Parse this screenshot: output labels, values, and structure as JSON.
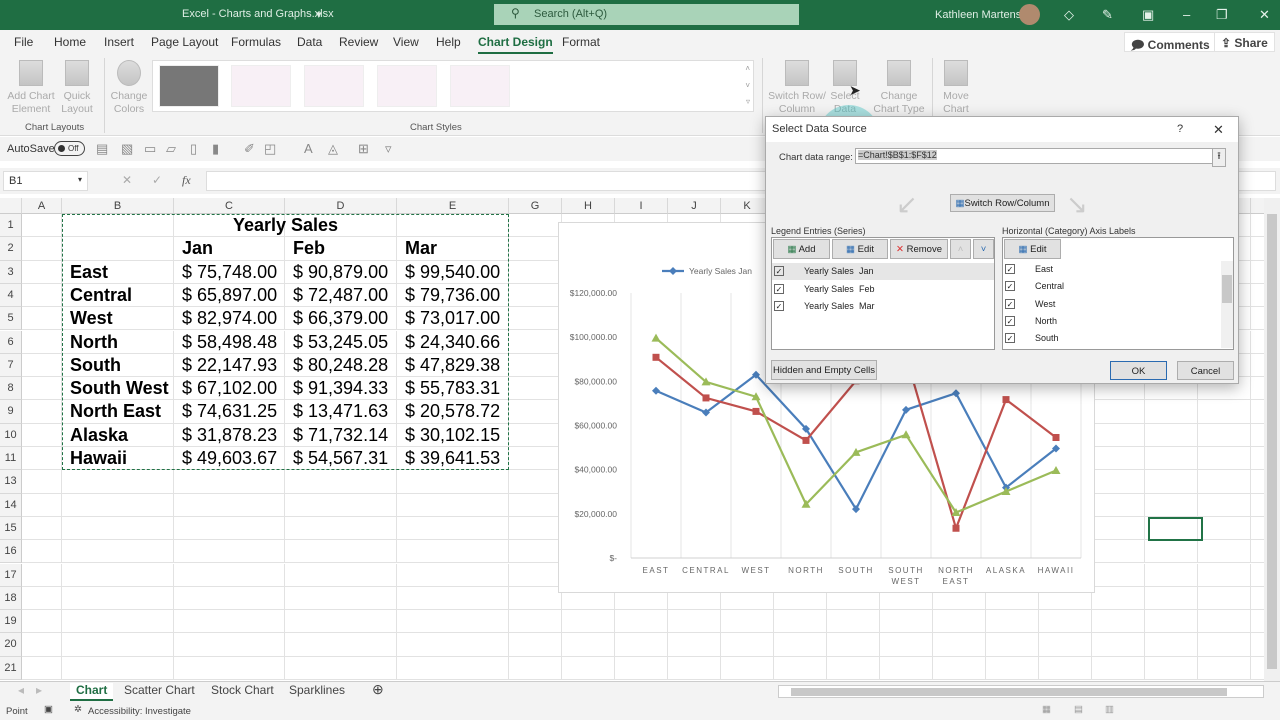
{
  "titlebar": {
    "title": "Excel - Charts and Graphs.xlsx",
    "search_placeholder": "Search (Alt+Q)",
    "user": "Kathleen Martens"
  },
  "menu": [
    "File",
    "Home",
    "Insert",
    "Page Layout",
    "Formulas",
    "Data",
    "Review",
    "View",
    "Help",
    "Chart Design",
    "Format"
  ],
  "active_menu": "Chart Design",
  "top_buttons": {
    "comments": "Comments",
    "share": "Share"
  },
  "ribbon": {
    "add_chart": "Add Chart Element",
    "quick_layout": "Quick Layout",
    "change_colors": "Change Colors",
    "switch_row": "Switch Row/ Column",
    "select_data": "Select Data",
    "change_type": "Change Chart Type",
    "move_chart": "Move Chart",
    "group_layouts": "Chart Layouts",
    "group_styles": "Chart Styles"
  },
  "qat": {
    "autosave": "AutoSave",
    "toggle": "Off"
  },
  "formula_bar": {
    "name_box": "B1",
    "value": ""
  },
  "columns": [
    "A",
    "B",
    "C",
    "D",
    "E",
    "G",
    "H",
    "I",
    "J",
    "K",
    "L",
    "M",
    "N",
    "O",
    "P",
    "Q",
    "R",
    "S",
    "T",
    "U"
  ],
  "rows": [
    "1",
    "2",
    "3",
    "4",
    "5",
    "6",
    "7",
    "8",
    "9",
    "10",
    "11",
    "13",
    "14",
    "15",
    "16",
    "17",
    "18",
    "19",
    "20",
    "21"
  ],
  "table": {
    "title": "Yearly Sales",
    "headers": [
      "Jan",
      "Feb",
      "Mar"
    ],
    "rows": [
      [
        "East",
        "$ 75,748.00",
        "$ 90,879.00",
        "$ 99,540.00"
      ],
      [
        "Central",
        "$ 65,897.00",
        "$ 72,487.00",
        "$ 79,736.00"
      ],
      [
        "West",
        "$ 82,974.00",
        "$ 66,379.00",
        "$ 73,017.00"
      ],
      [
        "North",
        "$ 58,498.48",
        "$ 53,245.05",
        "$ 24,340.66"
      ],
      [
        "South",
        "$ 22,147.93",
        "$ 80,248.28",
        "$ 47,829.38"
      ],
      [
        "South West",
        "$ 67,102.00",
        "$ 91,394.33",
        "$ 55,783.31"
      ],
      [
        "North East",
        "$ 74,631.25",
        "$ 13,471.63",
        "$ 20,578.72"
      ],
      [
        "Alaska",
        "$ 31,878.23",
        "$ 71,732.14",
        "$ 30,102.15"
      ],
      [
        "Hawaii",
        "$ 49,603.67",
        "$ 54,567.31",
        "$ 39,641.53"
      ]
    ]
  },
  "chart_data": {
    "type": "line",
    "categories": [
      "EAST",
      "CENTRAL",
      "WEST",
      "NORTH",
      "SOUTH",
      "SOUTH WEST",
      "NORTH EAST",
      "ALASKA",
      "HAWAII"
    ],
    "ylim": [
      0,
      120000
    ],
    "yticks": [
      "$-",
      "$20,000.00",
      "$40,000.00",
      "$60,000.00",
      "$80,000.00",
      "$100,000.00",
      "$120,000.00"
    ],
    "grid": "vertical",
    "legend": "top",
    "legend_label": "Yearly Sales  Jan",
    "series": [
      {
        "name": "Yearly Sales Jan",
        "color": "#4a7ebb",
        "marker": "diamond",
        "values": [
          75748,
          65897,
          82974,
          58498.48,
          22147.93,
          67102,
          74631.25,
          31878.23,
          49603.67
        ]
      },
      {
        "name": "Yearly Sales Feb",
        "color": "#c0504d",
        "marker": "square",
        "values": [
          90879,
          72487,
          66379,
          53245.05,
          80248.28,
          91394.33,
          13471.63,
          71732.14,
          54567.31
        ]
      },
      {
        "name": "Yearly Sales Mar",
        "color": "#9bbb59",
        "marker": "triangle",
        "values": [
          99540,
          79736,
          73017,
          24340.66,
          47829.38,
          55783.31,
          20578.72,
          30102.15,
          39641.53
        ]
      }
    ]
  },
  "dialog": {
    "title": "Select Data Source",
    "help": "?",
    "range_label": "Chart data range:",
    "range_value": "=Chart!$B$1:$F$12",
    "switch": "Switch Row/Column",
    "legend_title": "Legend Entries (Series)",
    "axis_title": "Horizontal (Category) Axis Labels",
    "add": "Add",
    "edit": "Edit",
    "remove": "Remove",
    "axis_edit": "Edit",
    "series": [
      {
        "name": "Yearly Sales",
        "month": "Jan"
      },
      {
        "name": "Yearly Sales",
        "month": "Feb"
      },
      {
        "name": "Yearly Sales",
        "month": "Mar"
      }
    ],
    "categories": [
      "East",
      "Central",
      "West",
      "North",
      "South"
    ],
    "hidden": "Hidden and Empty Cells",
    "ok": "OK",
    "cancel": "Cancel"
  },
  "sheets": [
    "Chart",
    "Scatter Chart",
    "Stock Chart",
    "Sparklines"
  ],
  "status": {
    "mode": "Point",
    "accessibility": "Accessibility: Investigate"
  }
}
